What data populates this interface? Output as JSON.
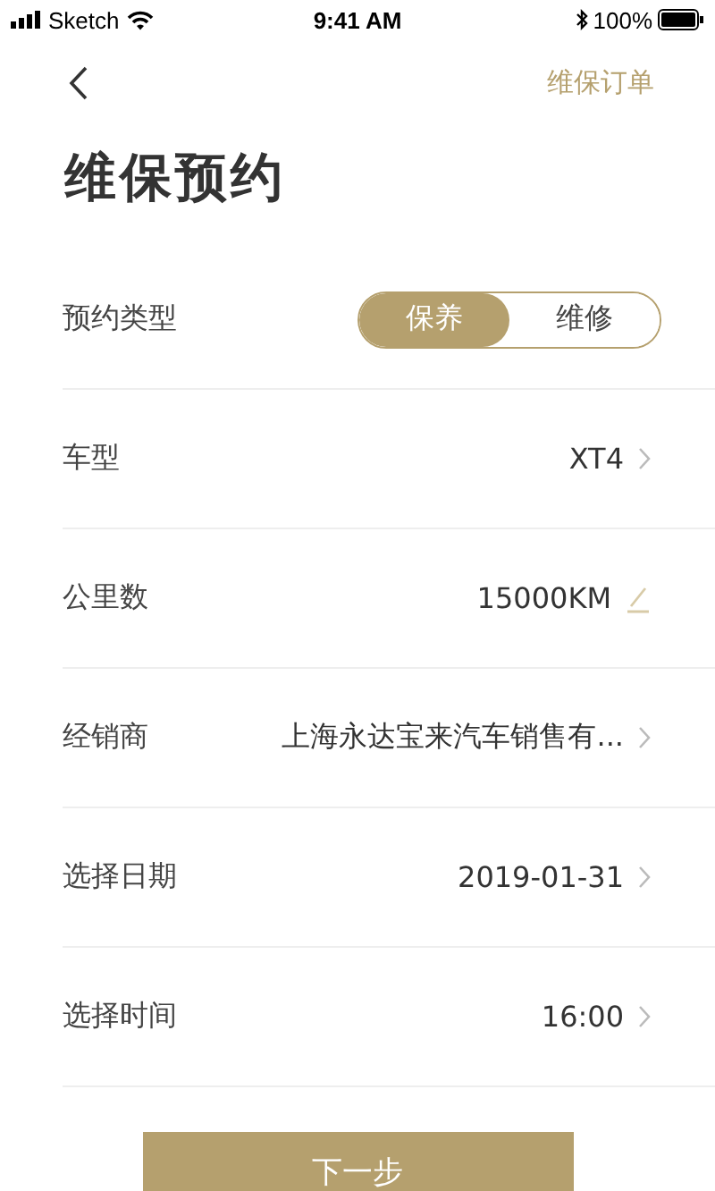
{
  "status_bar": {
    "carrier": "Sketch",
    "time": "9:41 AM",
    "battery": "100%"
  },
  "nav": {
    "action": "维保订单"
  },
  "title": "维保预约",
  "rows": [
    {
      "kind": "segment",
      "label": "预约类型",
      "options": [
        {
          "label": "保养",
          "selected": true
        },
        {
          "label": "维修",
          "selected": false
        }
      ]
    },
    {
      "kind": "select",
      "label": "车型",
      "value": "XT4"
    },
    {
      "kind": "edit",
      "label": "公里数",
      "value": "15000KM"
    },
    {
      "kind": "select",
      "label": "经销商",
      "value": "上海永达宝来汽车销售有..."
    },
    {
      "kind": "select",
      "label": "选择日期",
      "value": "2019-01-31"
    },
    {
      "kind": "select",
      "label": "选择时间",
      "value": "16:00"
    }
  ],
  "next_button": "下一步"
}
